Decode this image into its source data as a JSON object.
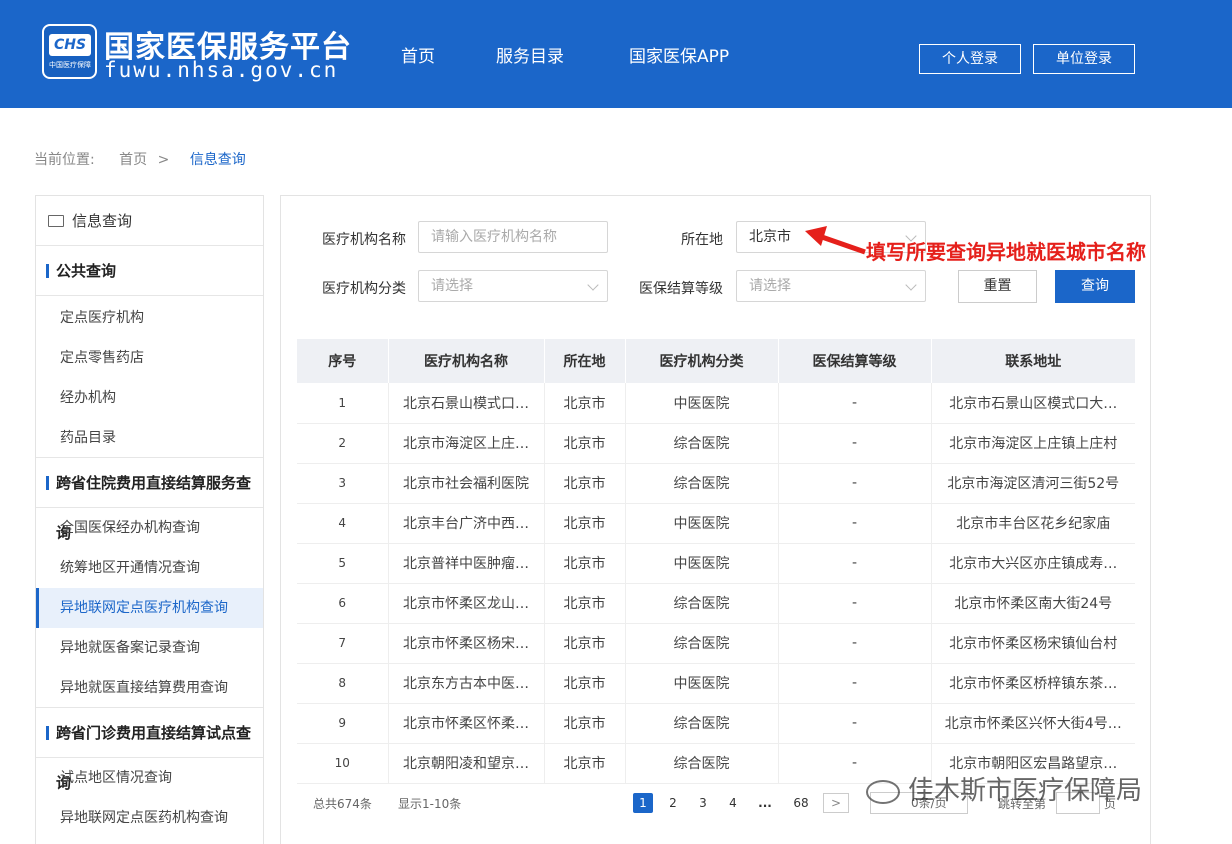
{
  "header": {
    "logo_text": "CHS",
    "logo_sub": "中国医疗保障",
    "title": "国家医保服务平台",
    "url": "fuwu.nhsa.gov.cn",
    "nav": [
      "首页",
      "服务目录",
      "国家医保APP"
    ],
    "personal_login": "个人登录",
    "unit_login": "单位登录"
  },
  "breadcrumb": {
    "prefix": "当前位置:",
    "home": "首页",
    "sep": ">",
    "current": "信息查询"
  },
  "sidebar": {
    "header": "信息查询",
    "sections": [
      {
        "title": "公共查询",
        "items": [
          "定点医疗机构",
          "定点零售药店",
          "经办机构",
          "药品目录"
        ]
      },
      {
        "title": "跨省住院费用直接结算服务查询",
        "items": [
          "全国医保经办机构查询",
          "统筹地区开通情况查询",
          "异地联网定点医疗机构查询",
          "异地就医备案记录查询",
          "异地就医直接结算费用查询"
        ]
      },
      {
        "title": "跨省门诊费用直接结算试点查询",
        "items": [
          "试点地区情况查询",
          "异地联网定点医药机构查询"
        ]
      }
    ],
    "active_item": "异地联网定点医疗机构查询"
  },
  "form": {
    "name_label": "医疗机构名称",
    "name_placeholder": "请输入医疗机构名称",
    "location_label": "所在地",
    "location_value": "北京市",
    "category_label": "医疗机构分类",
    "category_placeholder": "请选择",
    "level_label": "医保结算等级",
    "level_placeholder": "请选择",
    "reset": "重置",
    "query": "查询"
  },
  "annotation": "填写所要查询异地就医城市名称",
  "table": {
    "headers": [
      "序号",
      "医疗机构名称",
      "所在地",
      "医疗机构分类",
      "医保结算等级",
      "联系地址"
    ],
    "rows": [
      [
        "1",
        "北京石景山模式口…",
        "北京市",
        "中医医院",
        "-",
        "北京市石景山区模式口大…"
      ],
      [
        "2",
        "北京市海淀区上庄…",
        "北京市",
        "综合医院",
        "-",
        "北京市海淀区上庄镇上庄村"
      ],
      [
        "3",
        "北京市社会福利医院",
        "北京市",
        "综合医院",
        "-",
        "北京市海淀区清河三街52号"
      ],
      [
        "4",
        "北京丰台广济中西…",
        "北京市",
        "中医医院",
        "-",
        "北京市丰台区花乡纪家庙"
      ],
      [
        "5",
        "北京普祥中医肿瘤…",
        "北京市",
        "中医医院",
        "-",
        "北京市大兴区亦庄镇成寿…"
      ],
      [
        "6",
        "北京市怀柔区龙山…",
        "北京市",
        "综合医院",
        "-",
        "北京市怀柔区南大街24号"
      ],
      [
        "7",
        "北京市怀柔区杨宋…",
        "北京市",
        "综合医院",
        "-",
        "北京市怀柔区杨宋镇仙台村"
      ],
      [
        "8",
        "北京东方古本中医…",
        "北京市",
        "中医医院",
        "-",
        "北京市怀柔区桥梓镇东茶…"
      ],
      [
        "9",
        "北京市怀柔区怀柔…",
        "北京市",
        "综合医院",
        "-",
        "北京市怀柔区兴怀大街4号…"
      ],
      [
        "10",
        "北京朝阳凌和望京…",
        "北京市",
        "综合医院",
        "-",
        "北京市朝阳区宏昌路望京…"
      ]
    ]
  },
  "pagination": {
    "total": "总共674条",
    "showing": "显示1-10条",
    "pages": [
      "1",
      "2",
      "3",
      "4"
    ],
    "ellipsis": "...",
    "last": "68",
    "next": ">",
    "page_size": "0条/页",
    "goto_label": "跳转至第",
    "goto_suffix": "页"
  },
  "watermark": "佳木斯市医疗保障局"
}
